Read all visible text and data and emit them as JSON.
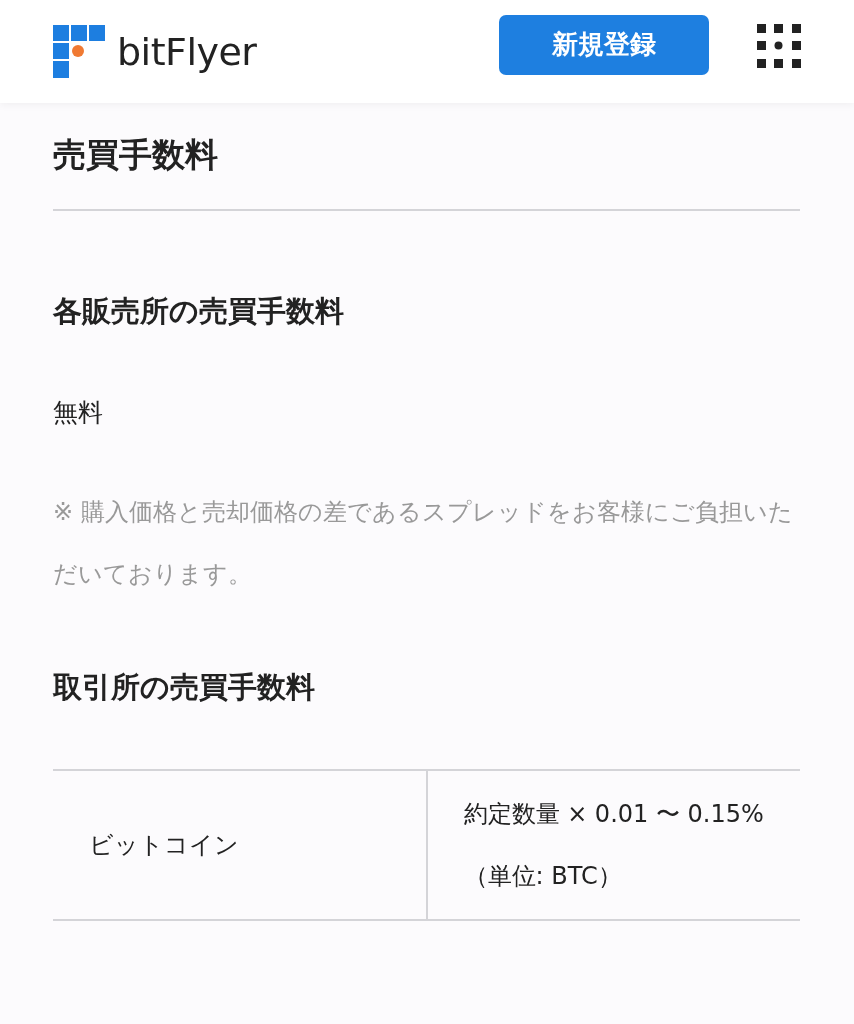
{
  "header": {
    "logo_text": "bitFlyer",
    "signup_button": "新規登録"
  },
  "page_title": "売買手数料",
  "sections": [
    {
      "heading": "各販売所の売買手数料",
      "value": "無料",
      "note": "※ 購入価格と売却価格の差であるスプレッドをお客様にご負担いただいております。"
    },
    {
      "heading": "取引所の売買手数料",
      "table": {
        "rows": [
          {
            "cells": [
              "ビットコイン",
              "約定数量 × 0.01 〜 0.15%（単位: BTC）"
            ]
          }
        ]
      }
    }
  ]
}
